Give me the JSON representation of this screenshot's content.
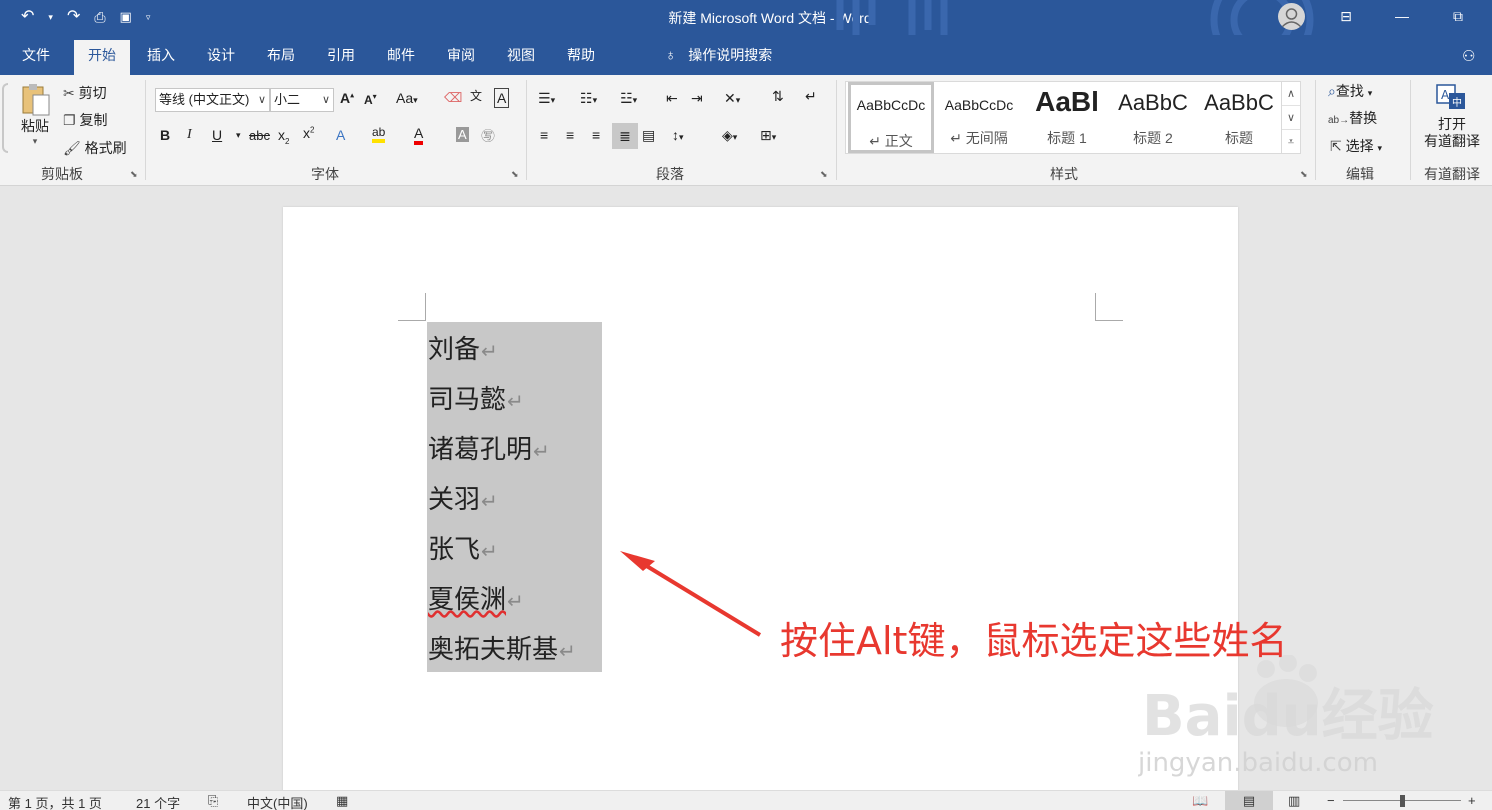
{
  "window": {
    "title": "新建 Microsoft Word 文档  -  Word"
  },
  "qat": {
    "undo": "↶",
    "redo": "↷",
    "preview": "⎙",
    "save": "💾",
    "customize": "▿"
  },
  "tabs": [
    "文件",
    "开始",
    "插入",
    "设计",
    "布局",
    "引用",
    "邮件",
    "审阅",
    "视图",
    "帮助"
  ],
  "active_tab": "开始",
  "tell_me": "操作说明搜索",
  "ribbon": {
    "clipboard": {
      "label": "剪贴板",
      "paste": "粘贴",
      "cut": "剪切",
      "copy": "复制",
      "format_painter": "格式刷"
    },
    "font": {
      "label": "字体",
      "font_name": "等线 (中文正文)",
      "font_size": "小二",
      "change_case": "Aa"
    },
    "paragraph": {
      "label": "段落"
    },
    "styles": {
      "label": "样式",
      "items": [
        {
          "sample": "AaBbCcDc",
          "name": "↵ 正文"
        },
        {
          "sample": "AaBbCcDc",
          "name": "↵ 无间隔"
        },
        {
          "sample": "AaBl",
          "name": "标题 1"
        },
        {
          "sample": "AaBbC",
          "name": "标题 2"
        },
        {
          "sample": "AaBbC",
          "name": "标题"
        }
      ]
    },
    "editing": {
      "label": "编辑",
      "find": "查找",
      "replace": "替换",
      "select": "选择"
    },
    "youdao": {
      "label": "有道翻译",
      "open_line1": "打开",
      "open_line2": "有道翻译"
    }
  },
  "document": {
    "lines": [
      "刘备",
      "司马懿",
      "诸葛孔明",
      "关羽",
      "张飞",
      "夏侯渊",
      "奥拓夫斯基"
    ],
    "paragraph_mark": "↵",
    "selection_color": "#c8c8c8"
  },
  "annotation": {
    "text": "按住Alt键，鼠标选定这些姓名",
    "color": "#e8382f"
  },
  "watermark": {
    "brand": "Baidu经验",
    "url": "jingyan.baidu.com"
  },
  "status": {
    "page": "第 1 页，共 1 页",
    "words": "21 个字",
    "language": "中文(中国)"
  },
  "colors": {
    "title_bar": "#2b579a",
    "ribbon_bg": "#f3f3f3",
    "canvas": "#e6e6e6"
  }
}
